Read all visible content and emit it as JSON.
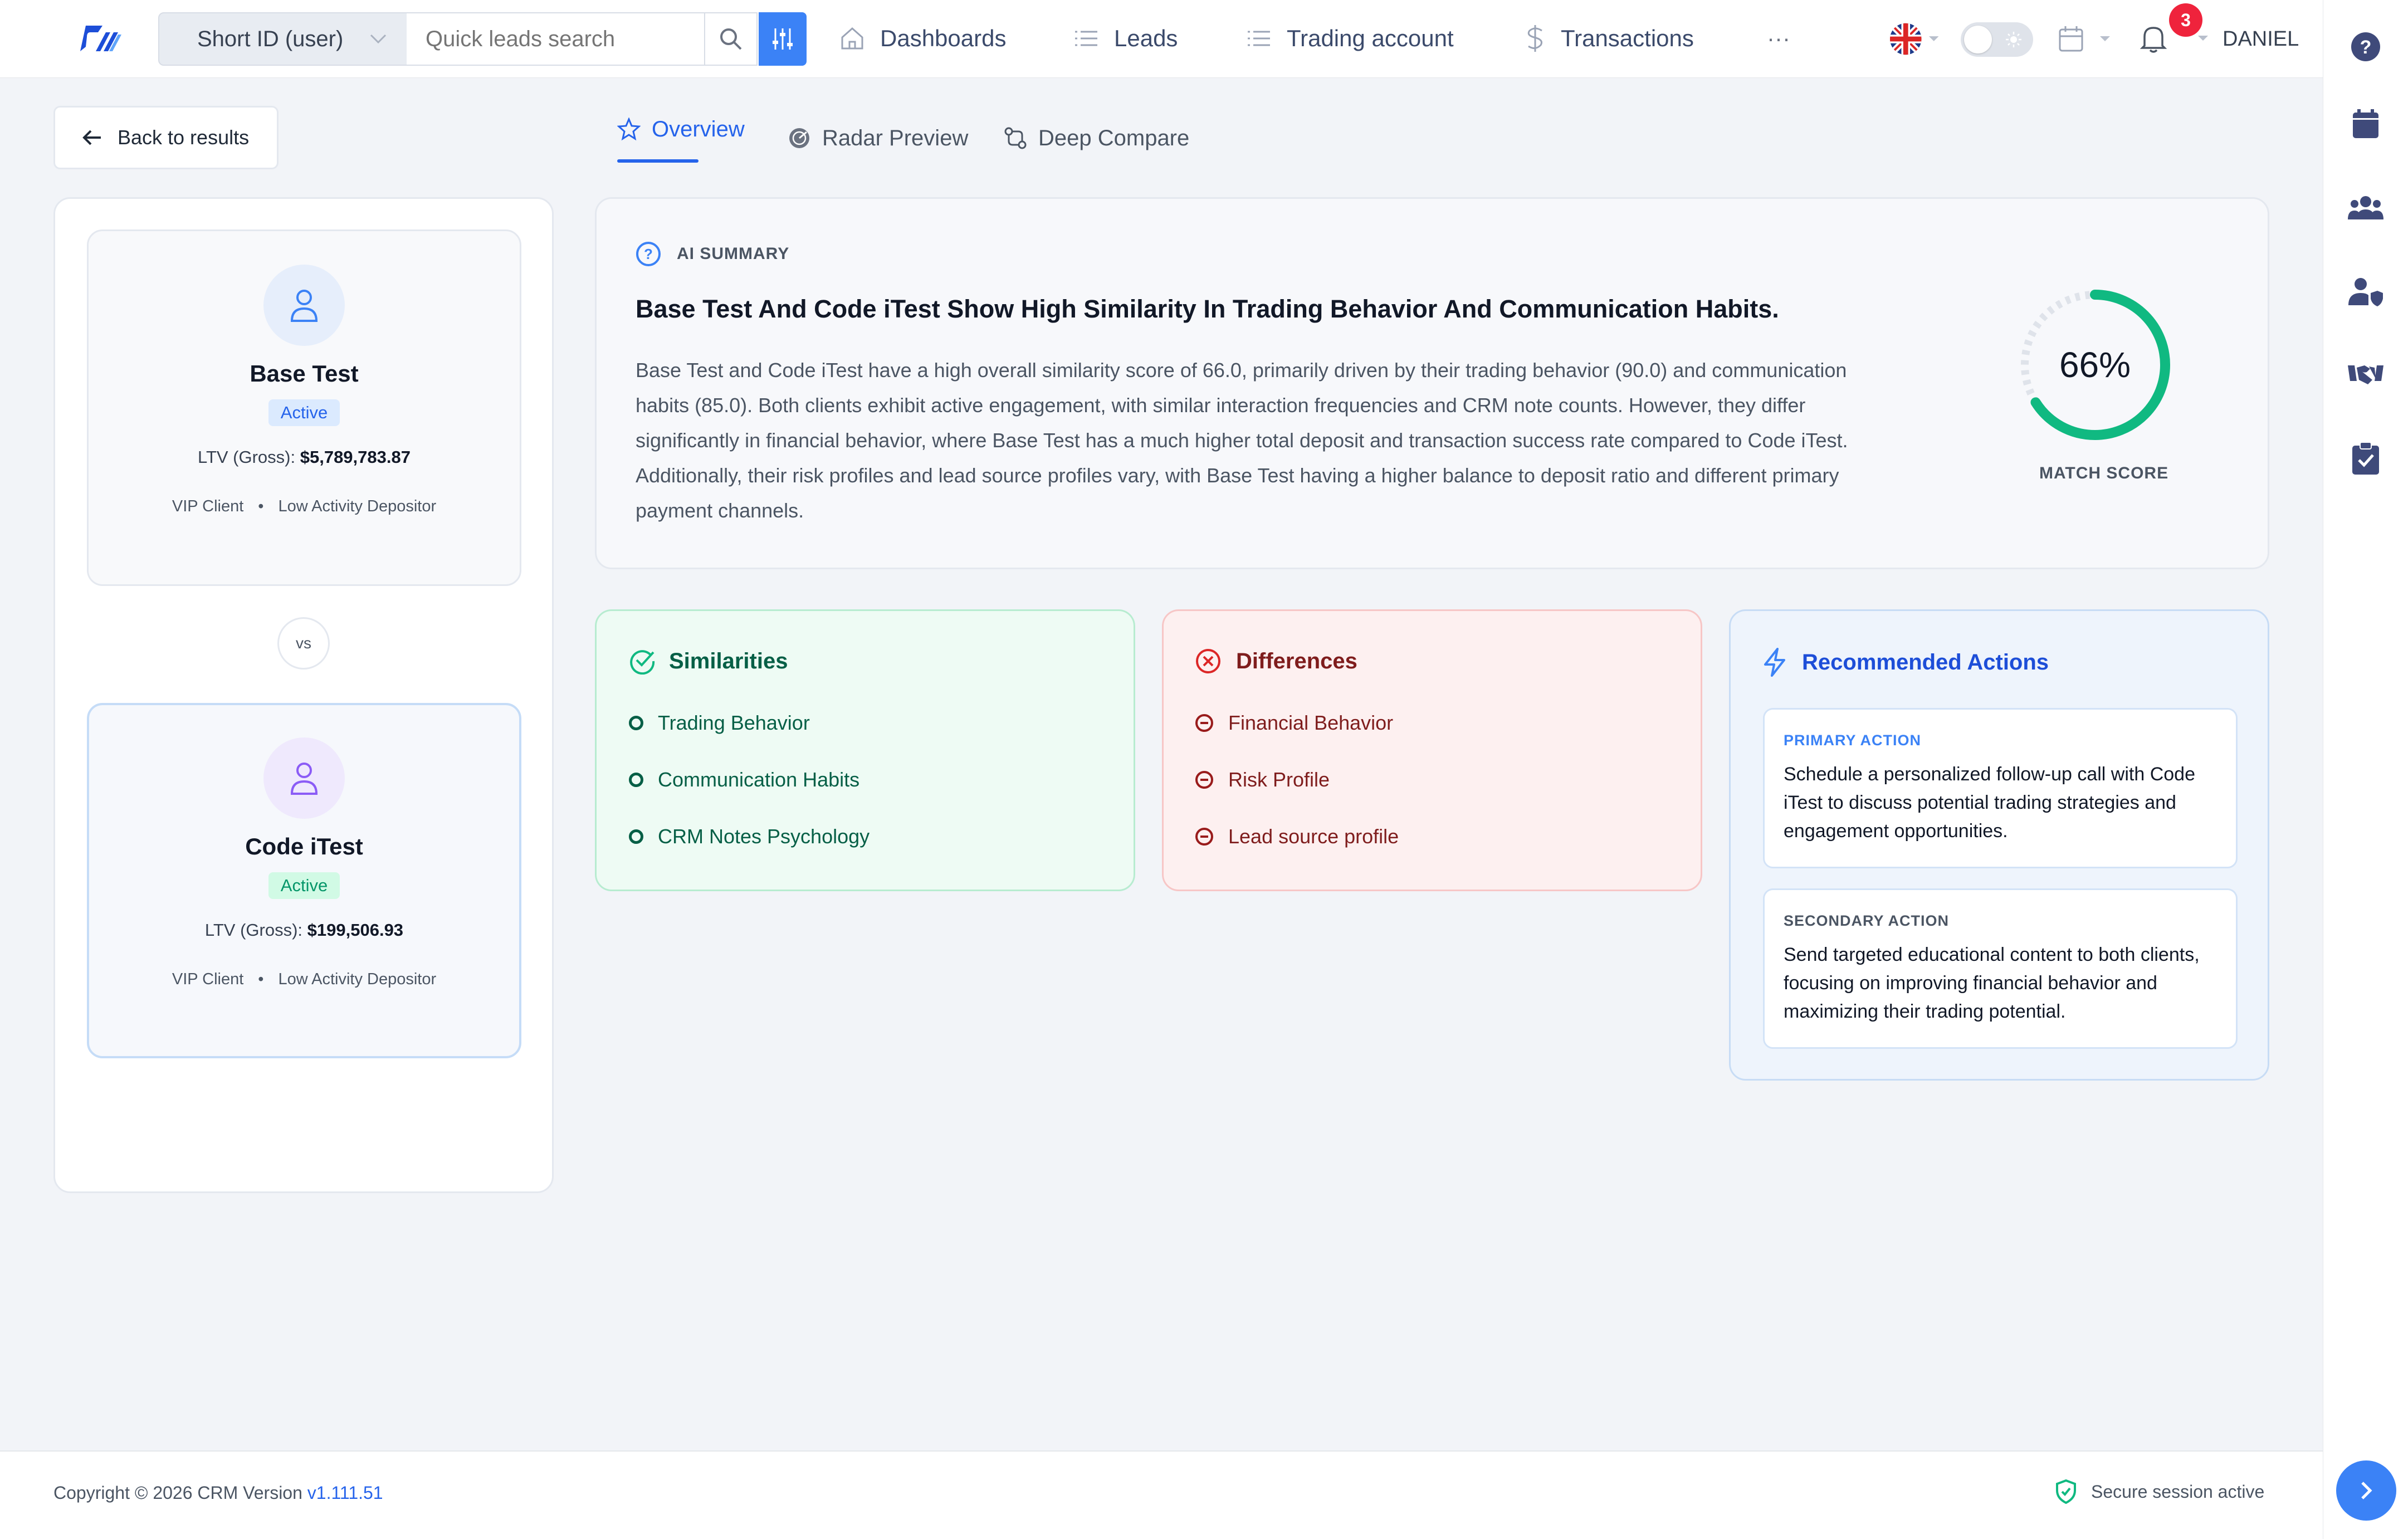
{
  "header": {
    "search_type": "Short ID (user)",
    "search_placeholder": "Quick leads search",
    "nav": [
      "Dashboards",
      "Leads",
      "Trading account",
      "Transactions"
    ],
    "more": "···",
    "notification_count": "3",
    "user": "DANIEL"
  },
  "back_label": "Back to results",
  "tabs": [
    "Overview",
    "Radar Preview",
    "Deep Compare"
  ],
  "clients": [
    {
      "name": "Base Test",
      "status": "Active",
      "ltv_label": "LTV (Gross):",
      "ltv_value": "$5,789,783.87",
      "tag1": "VIP Client",
      "tag2": "Low Activity Depositor"
    },
    {
      "name": "Code iTest",
      "status": "Active",
      "ltv_label": "LTV (Gross):",
      "ltv_value": "$199,506.93",
      "tag1": "VIP Client",
      "tag2": "Low Activity Depositor"
    }
  ],
  "vs_label": "vs",
  "summary": {
    "label": "AI SUMMARY",
    "title": "Base Test And Code iTest Show High Similarity In Trading Behavior And Communication Habits.",
    "lines": [
      "Base Test and Code iTest have a high overall similarity score of 66.0, primarily driven by their trading behavior (90.0) and communication",
      "habits (85.0). Both clients exhibit active engagement, with similar interaction frequencies and CRM note counts. However, they differ",
      "significantly in financial behavior, where Base Test has a much higher total deposit and transaction success rate compared to Code iTest.",
      "Additionally, their risk profiles and lead source profiles vary, with Base Test having a higher balance to deposit ratio and different primary",
      "payment channels."
    ],
    "score_text": "66%",
    "score_value": 0.66,
    "score_label": "MATCH SCORE"
  },
  "similarities": {
    "title": "Similarities",
    "items": [
      "Trading Behavior",
      "Communication Habits",
      "CRM Notes Psychology"
    ]
  },
  "differences": {
    "title": "Differences",
    "items": [
      "Financial Behavior",
      "Risk Profile",
      "Lead source profile"
    ]
  },
  "actions": {
    "title": "Recommended Actions",
    "primary_label": "PRIMARY ACTION",
    "primary_lines": [
      "Schedule a personalized follow-up call with Code",
      "iTest to discuss potential trading strategies and",
      "engagement opportunities."
    ],
    "secondary_label": "SECONDARY ACTION",
    "secondary_lines": [
      "Send targeted educational content to both clients,",
      "focusing on improving financial behavior and",
      "maximizing their trading potential."
    ]
  },
  "footer": {
    "copyright": "Copyright © 2026 CRM Version",
    "version": "v1.111.51",
    "secure": "Secure session active"
  },
  "colors": {
    "accent": "#2563eb",
    "green": "#10b981",
    "red": "#dc2626",
    "purple": "#7c3aed"
  }
}
